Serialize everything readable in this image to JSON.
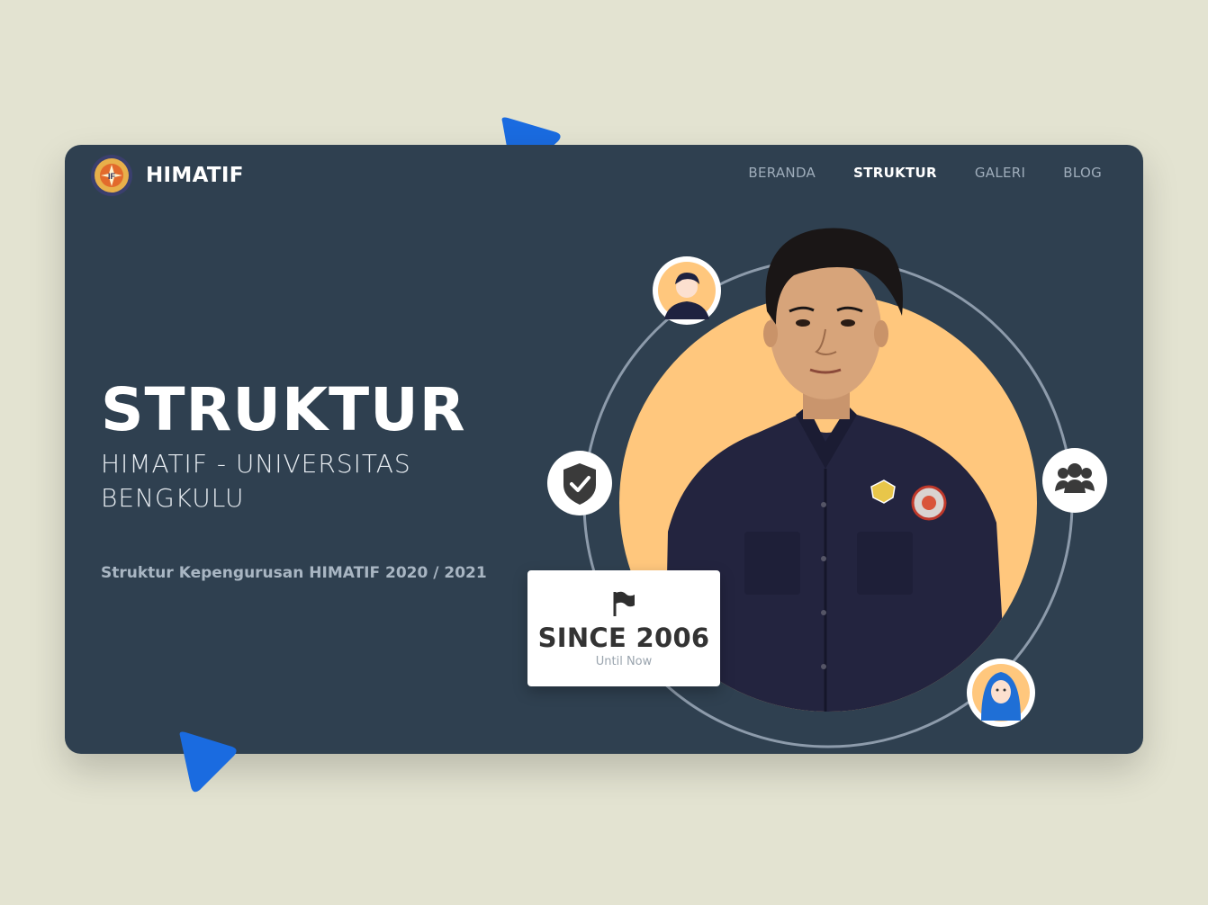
{
  "brand": {
    "name": "HIMATIF",
    "logo_icon": "himatif-logo-icon"
  },
  "nav": {
    "items": [
      {
        "label": "BERANDA",
        "active": false
      },
      {
        "label": "STRUKTUR",
        "active": true
      },
      {
        "label": "GALERI",
        "active": false
      },
      {
        "label": "BLOG",
        "active": false
      }
    ]
  },
  "hero": {
    "title": "STRUKTUR",
    "subtitle": "HIMATIF - UNIVERSITAS BENGKULU",
    "description": "Struktur Kepengurusan HIMATIF 2020 / 2021"
  },
  "badge": {
    "title": "SINCE 2006",
    "subtitle": "Until Now",
    "icon": "flag-icon"
  },
  "icons": [
    "male-avatar-icon",
    "shield-check-icon",
    "users-group-icon",
    "female-avatar-icon",
    "person-photo"
  ],
  "colors": {
    "background": "#e3e3d1",
    "card": "#2f4050",
    "accent": "#1a6be0",
    "photo_circle": "#ffc77d"
  }
}
